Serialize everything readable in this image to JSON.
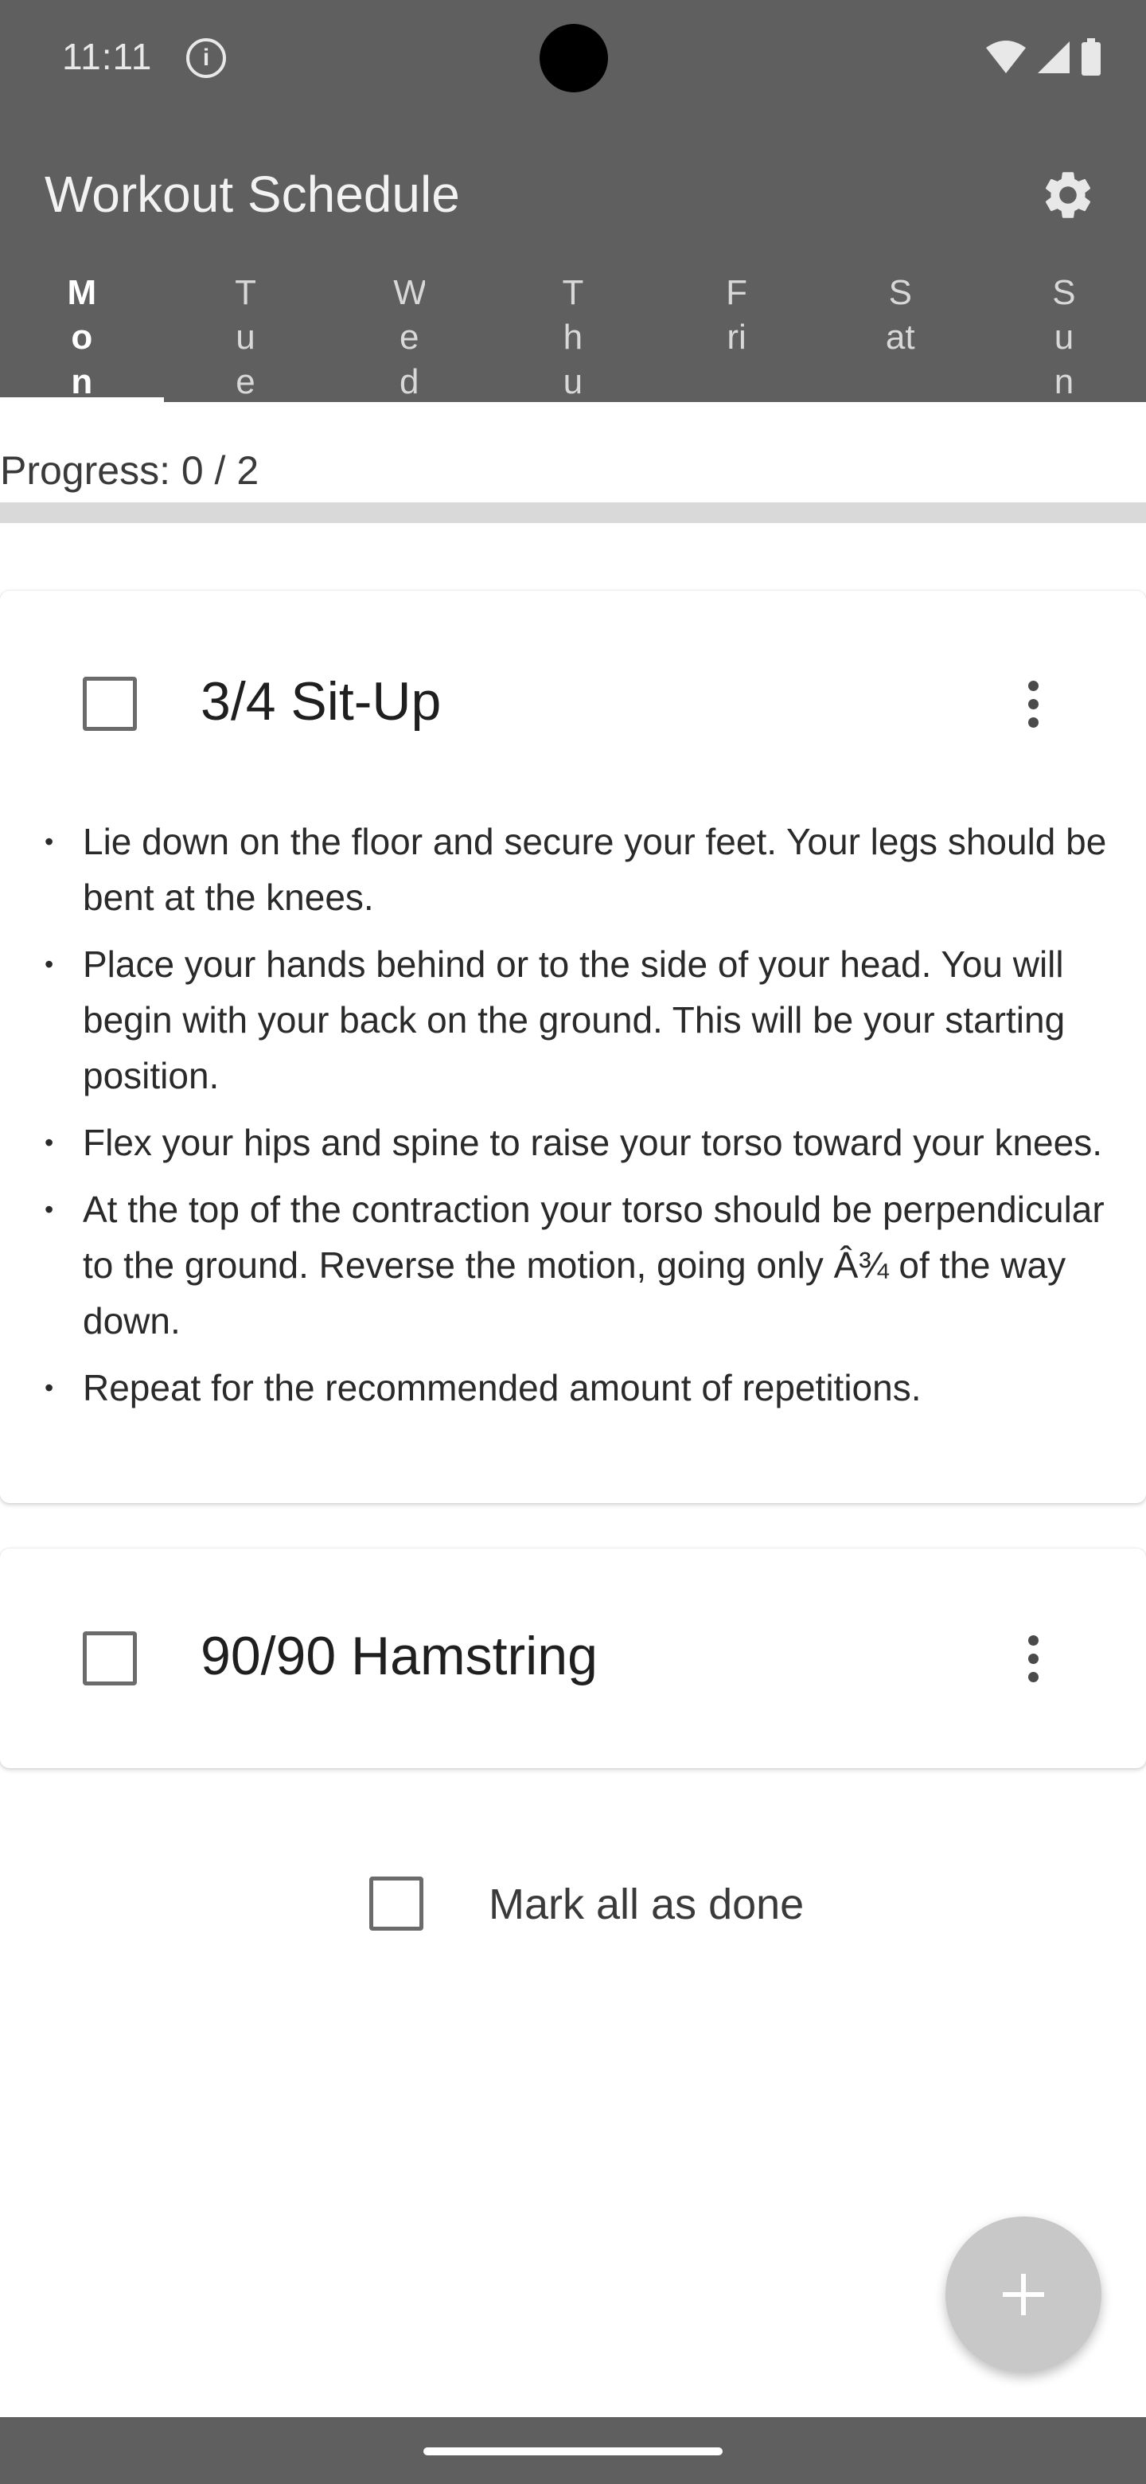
{
  "status_bar": {
    "time": "11:11",
    "info_icon": "info-icon",
    "icons": [
      "wifi-icon",
      "signal-icon",
      "battery-icon"
    ]
  },
  "app_bar": {
    "title": "Workout Schedule",
    "settings_icon": "gear-icon",
    "background_color": "#5f5f5f"
  },
  "tabs": [
    {
      "label": "Mon",
      "active": true
    },
    {
      "label": "Tue",
      "active": false
    },
    {
      "label": "Wed",
      "active": false
    },
    {
      "label": "Thu",
      "active": false
    },
    {
      "label": "Fri",
      "active": false
    },
    {
      "label": "Sat",
      "active": false
    },
    {
      "label": "Sun",
      "active": false
    }
  ],
  "progress": {
    "label": "Progress: 0 / 2",
    "completed": 0,
    "total": 2,
    "fraction": 0
  },
  "exercises": [
    {
      "title": "3/4 Sit-Up",
      "checked": false,
      "expanded": true,
      "steps": [
        "Lie down on the floor and secure your feet. Your legs should be bent at the knees.",
        "Place your hands behind or to the side of your head. You will begin with your back on the ground. This will be your starting position.",
        "Flex your hips and spine to raise your torso toward your knees.",
        "At the top of the contraction your torso should be perpendicular to the ground. Reverse the motion, going only Â¾ of the way down.",
        "Repeat for the recommended amount of repetitions."
      ]
    },
    {
      "title": "90/90 Hamstring",
      "checked": false,
      "expanded": false,
      "steps": []
    }
  ],
  "mark_all": {
    "label": "Mark all as done",
    "checked": false
  },
  "fab": {
    "icon": "plus-icon"
  }
}
